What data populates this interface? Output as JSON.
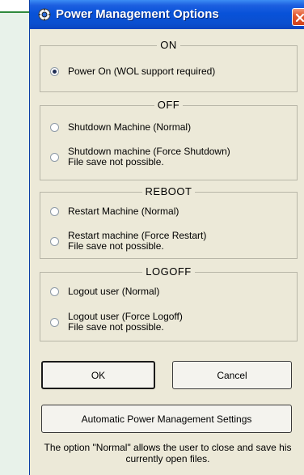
{
  "window": {
    "title": "Power Management Options"
  },
  "groups": [
    {
      "legend": "ON",
      "options": [
        {
          "label": "Power On (WOL support required)",
          "checked": true
        }
      ]
    },
    {
      "legend": "OFF",
      "options": [
        {
          "label": "Shutdown Machine (Normal)",
          "checked": false
        },
        {
          "label": "Shutdown machine (Force Shutdown)",
          "sub": "File save not possible.",
          "checked": false
        }
      ]
    },
    {
      "legend": "REBOOT",
      "options": [
        {
          "label": "Restart Machine (Normal)",
          "checked": false
        },
        {
          "label": "Restart machine (Force Restart)",
          "sub": "File save not possible.",
          "checked": false
        }
      ]
    },
    {
      "legend": "LOGOFF",
      "options": [
        {
          "label": "Logout user (Normal)",
          "checked": false
        },
        {
          "label": "Logout user (Force Logoff)",
          "sub": "File save not possible.",
          "checked": false
        }
      ]
    }
  ],
  "buttons": {
    "ok": "OK",
    "cancel": "Cancel",
    "auto": "Automatic Power Management Settings"
  },
  "note": "The option \"Normal\" allows the user to close and save his currently open files."
}
